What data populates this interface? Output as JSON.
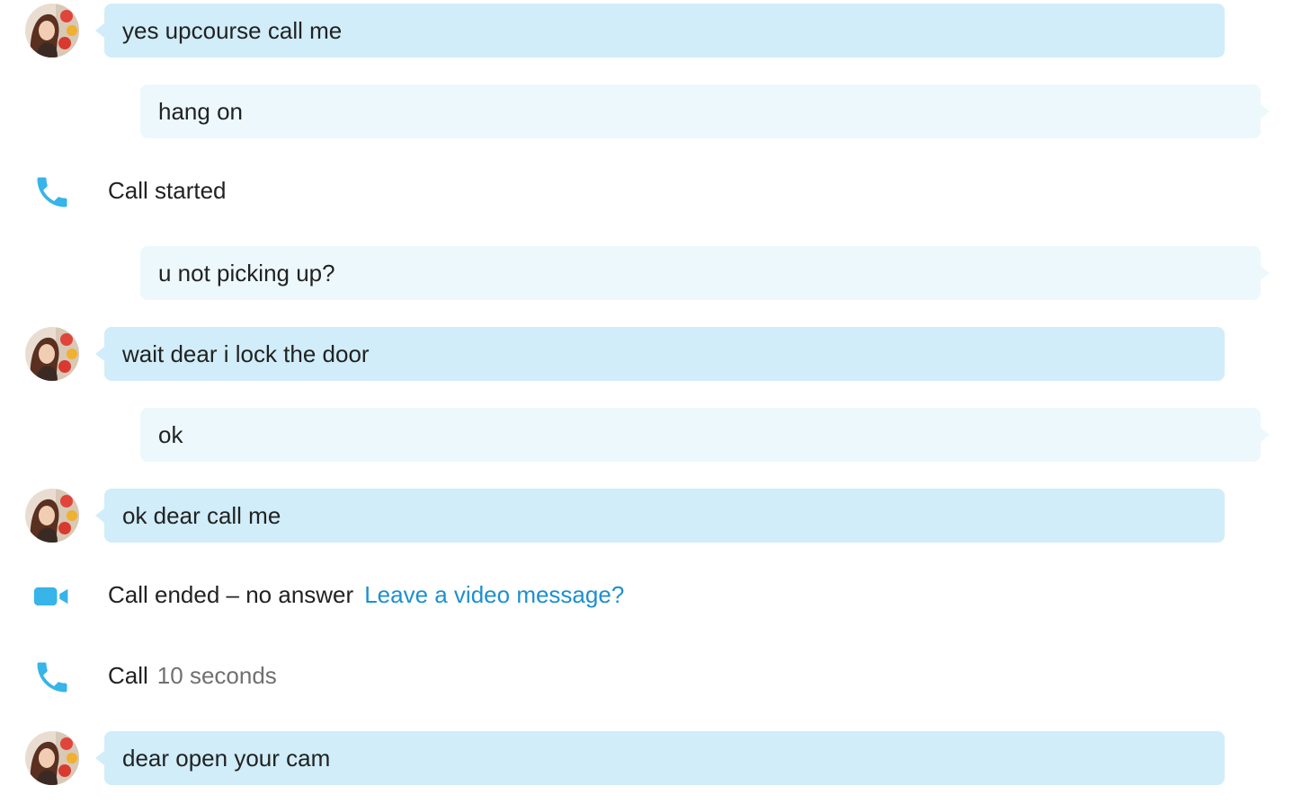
{
  "messages": [
    {
      "type": "incoming",
      "text": "yes upcourse call me"
    },
    {
      "type": "outgoing",
      "text": "hang on"
    },
    {
      "type": "event",
      "icon": "phone-icon",
      "text": "Call started"
    },
    {
      "type": "outgoing",
      "text": "u not picking up?"
    },
    {
      "type": "incoming",
      "text": "wait dear i lock the door"
    },
    {
      "type": "outgoing",
      "text": "ok"
    },
    {
      "type": "incoming",
      "text": "ok dear call me"
    },
    {
      "type": "event",
      "icon": "video-camera-icon",
      "text": "Call ended – no answer",
      "link": "Leave a video message?"
    },
    {
      "type": "event",
      "icon": "phone-icon",
      "text": "Call",
      "duration": "10 seconds"
    },
    {
      "type": "incoming",
      "text": "dear open your cam"
    }
  ],
  "colors": {
    "incoming_bubble": "#d0edf9",
    "outgoing_bubble": "#edf8fd",
    "accent": "#37b4e8",
    "link": "#1e8fcf"
  }
}
